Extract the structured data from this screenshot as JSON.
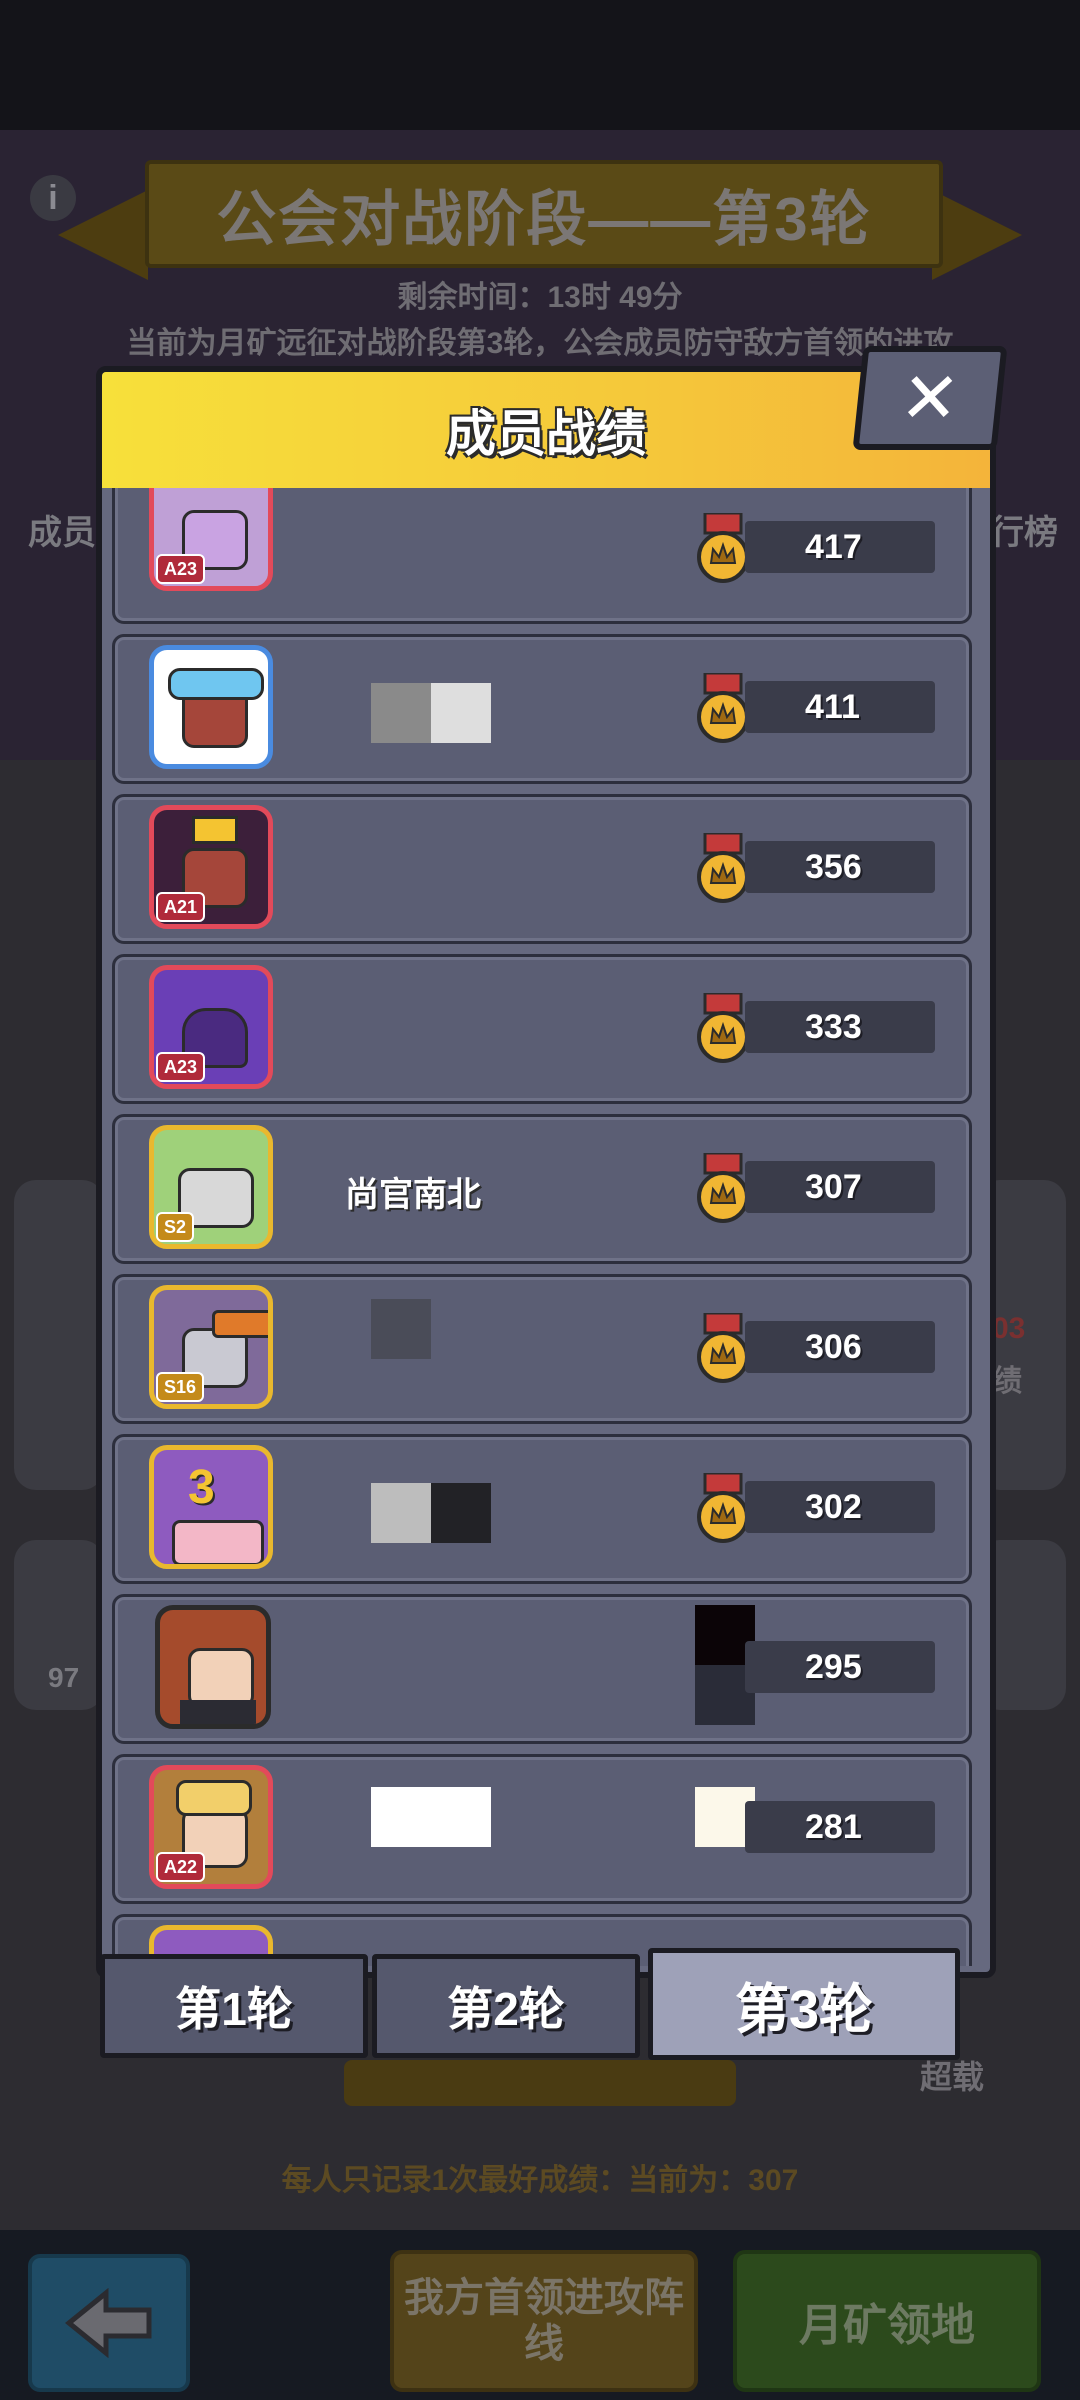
{
  "background": {
    "banner_title": "公会对战阶段——第3轮",
    "remaining_time": "剩余时间：13时 49分",
    "description": "当前为月矿远征对战阶段第3轮，公会成员防守敌方首领的进攻",
    "side_left": "成员",
    "side_right": "行榜",
    "left_number": "97",
    "right_number": "03",
    "right_label": "绩",
    "right_label2": "超载",
    "record_note": "每人只记录1次最好成绩：当前为：307",
    "btn_leader": "我方首领进攻阵线",
    "btn_territory": "月矿领地"
  },
  "modal": {
    "title": "成员战绩",
    "close_label": "✕",
    "rows": [
      {
        "avatar": "purple-ninja-avatar",
        "tag": "A23",
        "name": "",
        "score": "417"
      },
      {
        "avatar": "goggles-pilot-avatar",
        "tag": "",
        "name": "",
        "score": "411"
      },
      {
        "avatar": "crowned-pilot-avatar",
        "tag": "A21",
        "name": "",
        "score": "356"
      },
      {
        "avatar": "purple-knight-avatar",
        "tag": "A23",
        "name": "",
        "score": "333"
      },
      {
        "avatar": "cat-avatar",
        "tag": "S2",
        "name": "尚官南北",
        "score": "307"
      },
      {
        "avatar": "cannon-robot-avatar",
        "tag": "S16",
        "name": "",
        "score": "306"
      },
      {
        "avatar": "birthday-cake-avatar",
        "tag": "",
        "name": "",
        "score": "302"
      },
      {
        "avatar": "redhead-girl-avatar",
        "tag": "",
        "name": "",
        "score": "295"
      },
      {
        "avatar": "blonde-hero-avatar",
        "tag": "A22",
        "name": "",
        "score": "281"
      },
      {
        "avatar": "cake-avatar-partial",
        "tag": "",
        "name": "",
        "score": ""
      }
    ]
  },
  "tabs": [
    "第1轮",
    "第2轮",
    "第3轮"
  ],
  "active_tab": "第3轮"
}
